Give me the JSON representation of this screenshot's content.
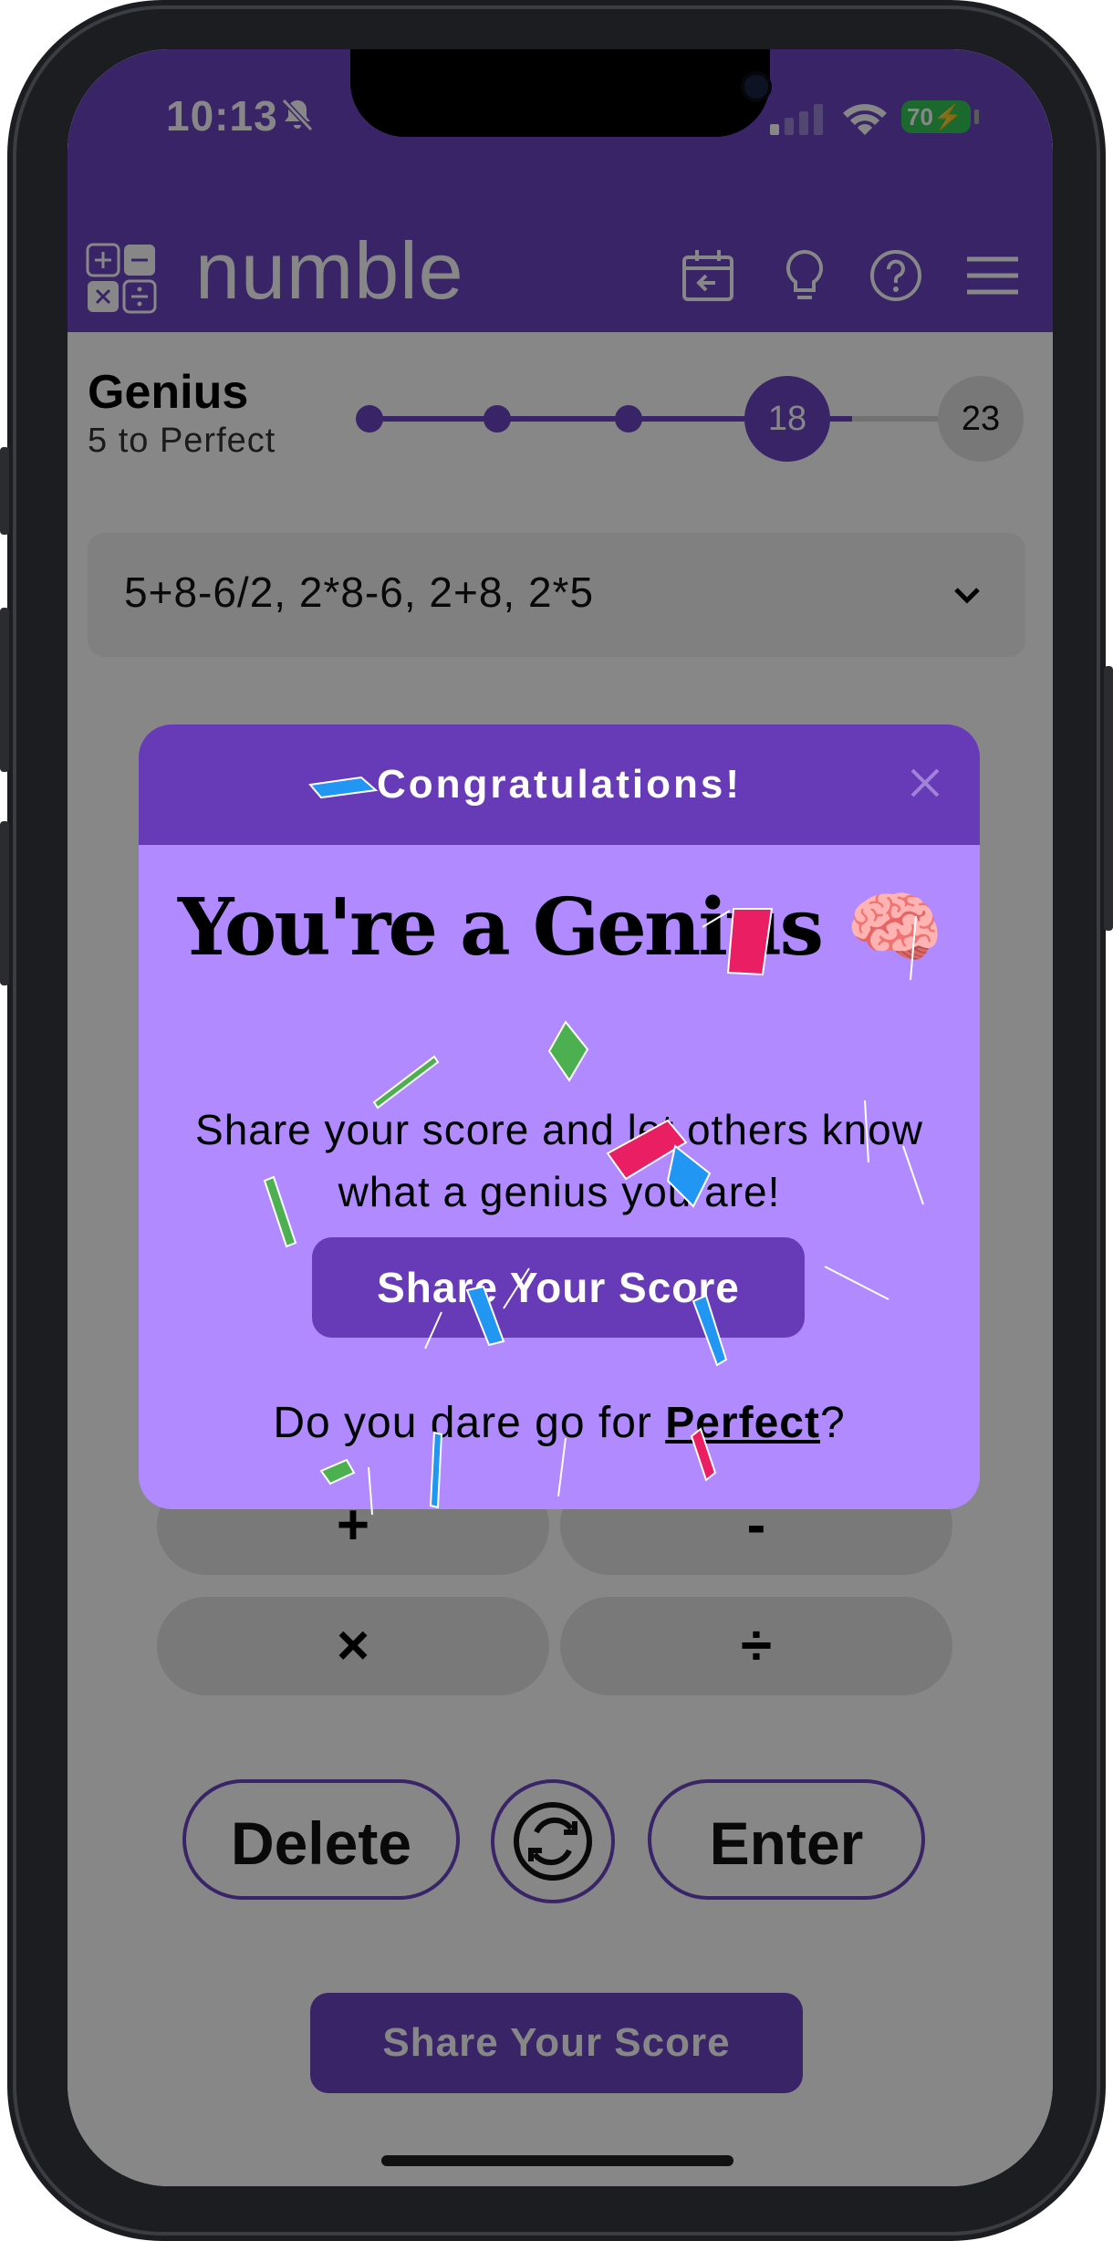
{
  "status_bar": {
    "time": "10:13",
    "battery": "70"
  },
  "header": {
    "brand": "numble"
  },
  "level": {
    "name": "Genius",
    "subtitle": "5 to Perfect",
    "current_score": "18",
    "perfect_score": "23"
  },
  "solution_dropdown": {
    "text": "5+8-6/2, 2*8-6, 2+8, 2*5"
  },
  "operators": {
    "plus": "+",
    "minus": "-",
    "times": "×",
    "divide": "÷"
  },
  "actions": {
    "delete": "Delete",
    "enter": "Enter"
  },
  "bottom": {
    "share_label": "Share Your Score"
  },
  "modal": {
    "title": "Congratulations!",
    "headline": "You're a Genius",
    "emoji": "🧠",
    "message": "Share your score and let others know what a genius you are!",
    "share_label": "Share Your Score",
    "dare_prefix": "Do you dare go for ",
    "dare_link": "Perfect",
    "dare_suffix": "?"
  },
  "colors": {
    "brand_purple": "#6a45c2",
    "modal_header": "#673ab7",
    "modal_body": "#b08afe",
    "confetti": [
      "#e91e63",
      "#4caf50",
      "#2196f3",
      "#ffffff"
    ]
  }
}
